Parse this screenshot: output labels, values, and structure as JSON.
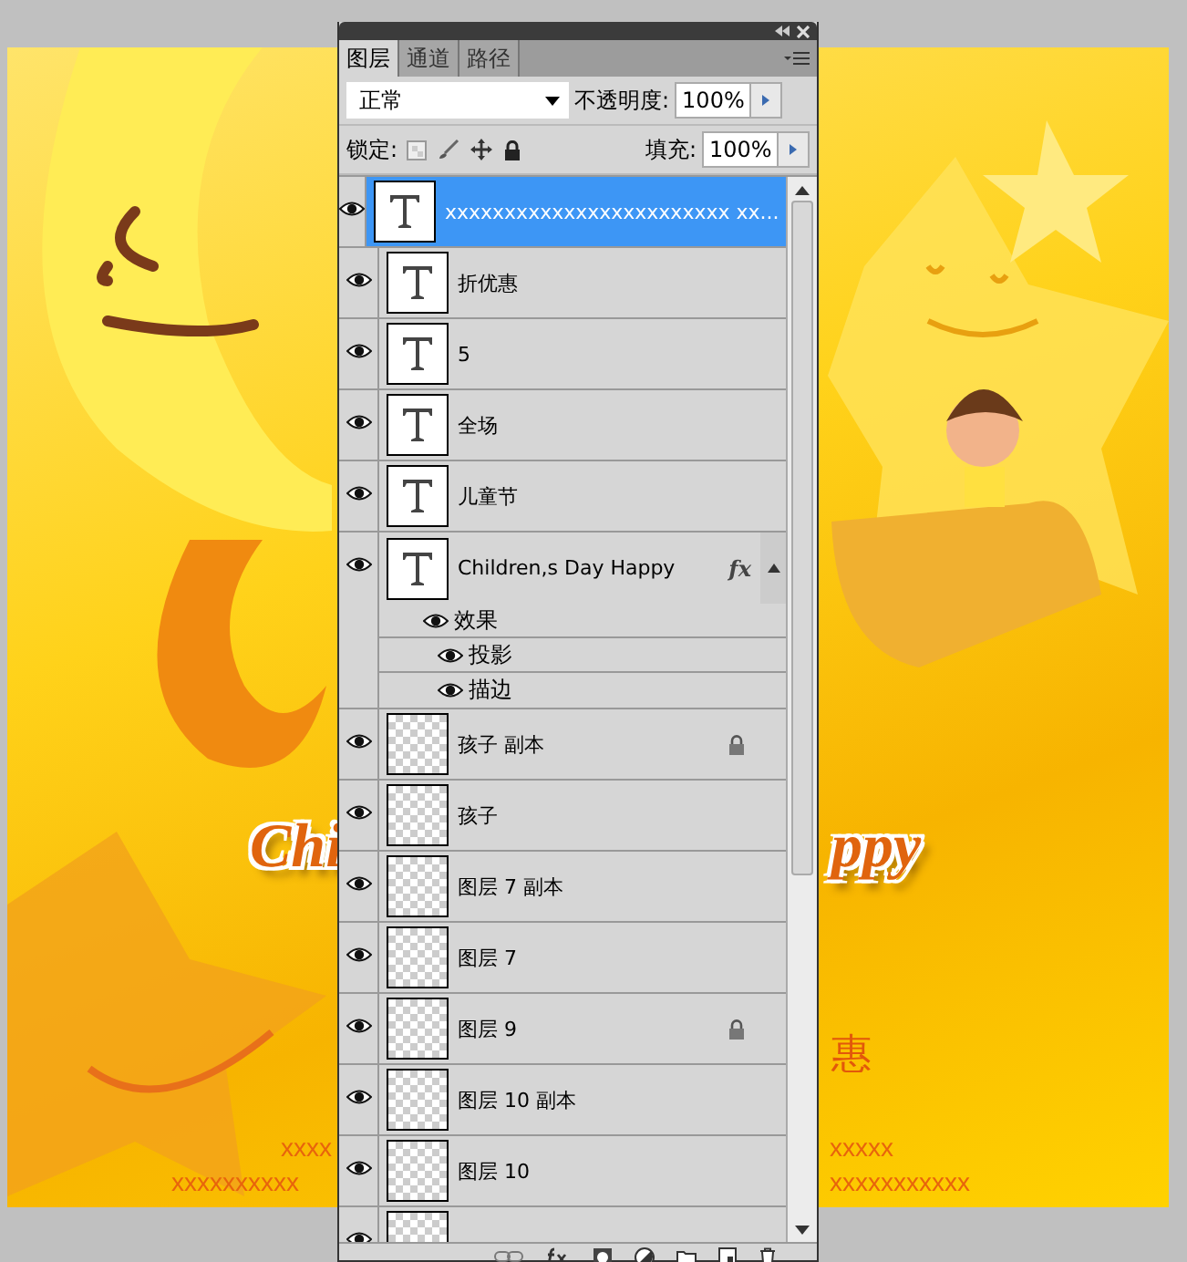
{
  "canvas": {
    "texts": [
      {
        "kind": "script",
        "text": "Chi"
      },
      {
        "kind": "script",
        "text": "ppy"
      },
      {
        "kind": "promo",
        "text": "惠"
      },
      {
        "kind": "small",
        "text": "xxxx"
      },
      {
        "kind": "small",
        "text": "xxxxx"
      },
      {
        "kind": "small",
        "text": "xxxxxxxxxx"
      },
      {
        "kind": "small",
        "text": "xxxxxxxxxxx"
      }
    ]
  },
  "panel": {
    "tabs": [
      {
        "label": "图层",
        "selected": true
      },
      {
        "label": "通道",
        "selected": false
      },
      {
        "label": "路径",
        "selected": false
      }
    ],
    "blend_mode": "正常",
    "opacity_label": "不透明度:",
    "opacity": "100%",
    "lock_label": "锁定:",
    "fill_label": "填充:",
    "fill": "100%",
    "layers": [
      {
        "kind": "text",
        "name": "xxxxxxxxxxxxxxxxxxxxxxxx xx...",
        "selected": true,
        "visible": true,
        "locked": false
      },
      {
        "kind": "text",
        "name": "折优惠",
        "selected": false,
        "visible": true,
        "locked": false
      },
      {
        "kind": "text",
        "name": "5",
        "selected": false,
        "visible": true,
        "locked": false
      },
      {
        "kind": "text",
        "name": "全场",
        "selected": false,
        "visible": true,
        "locked": false
      },
      {
        "kind": "text",
        "name": "儿童节",
        "selected": false,
        "visible": true,
        "locked": false
      },
      {
        "kind": "text",
        "name": "Children,s Day Happy",
        "selected": false,
        "visible": true,
        "locked": false,
        "fx_label": "fx",
        "expanded": true,
        "effects_label": "效果",
        "effects": [
          {
            "name": "投影",
            "visible": true
          },
          {
            "name": "描边",
            "visible": true
          }
        ]
      },
      {
        "kind": "pixel",
        "name": "孩子 副本",
        "selected": false,
        "visible": true,
        "locked": true
      },
      {
        "kind": "pixel",
        "name": "孩子",
        "selected": false,
        "visible": true,
        "locked": false
      },
      {
        "kind": "pixel",
        "name": "图层 7 副本",
        "selected": false,
        "visible": true,
        "locked": false
      },
      {
        "kind": "pixel",
        "name": "图层 7",
        "selected": false,
        "visible": true,
        "locked": false
      },
      {
        "kind": "pixel",
        "name": "图层 9",
        "selected": false,
        "visible": true,
        "locked": true
      },
      {
        "kind": "pixel",
        "name": "图层 10 副本",
        "selected": false,
        "visible": true,
        "locked": false
      },
      {
        "kind": "pixel",
        "name": "图层 10",
        "selected": false,
        "visible": true,
        "locked": false
      },
      {
        "kind": "pixel",
        "selected": false,
        "visible": true,
        "locked": false
      }
    ]
  }
}
